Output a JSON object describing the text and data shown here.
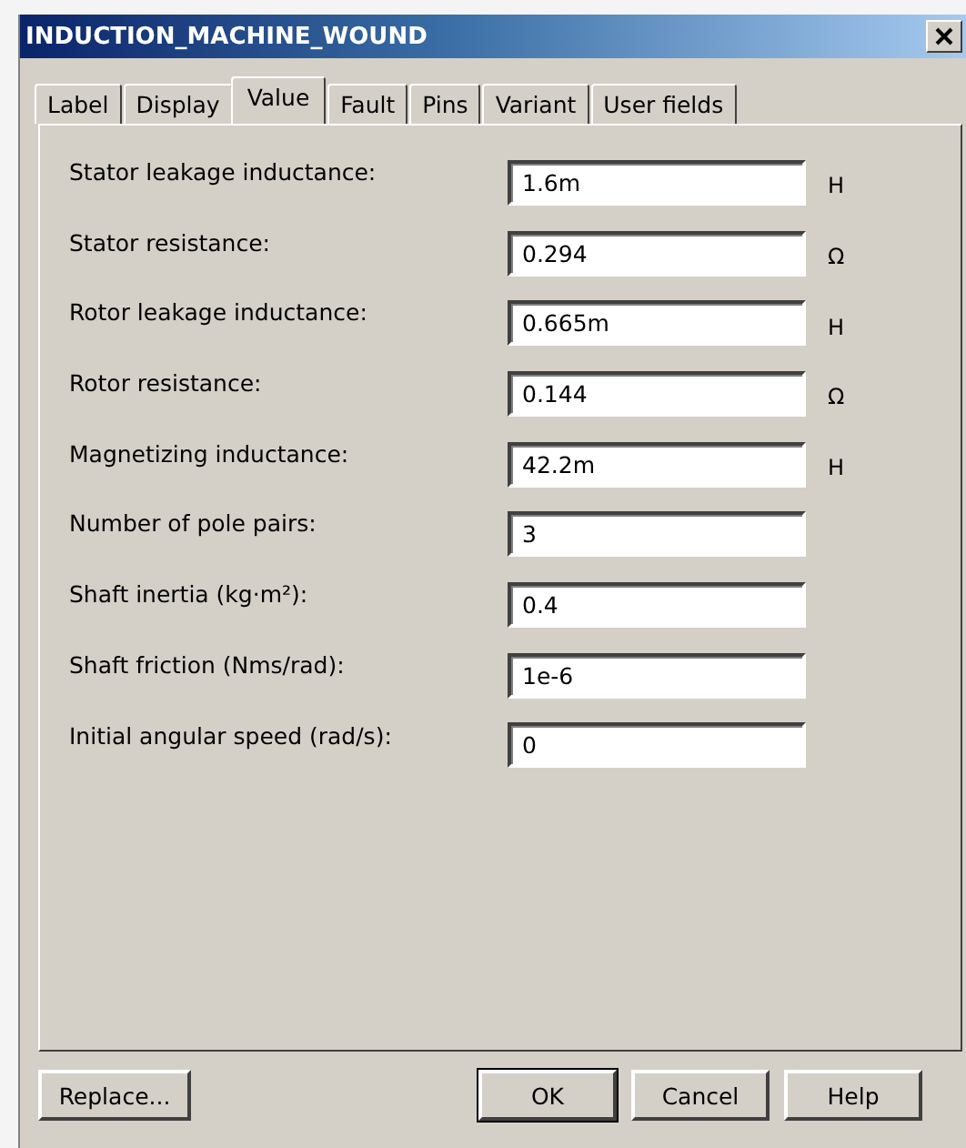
{
  "window": {
    "title": "INDUCTION_MACHINE_WOUND"
  },
  "tabs": [
    {
      "label": "Label",
      "selected": false
    },
    {
      "label": "Display",
      "selected": false
    },
    {
      "label": "Value",
      "selected": true
    },
    {
      "label": "Fault",
      "selected": false
    },
    {
      "label": "Pins",
      "selected": false
    },
    {
      "label": "Variant",
      "selected": false
    },
    {
      "label": "User fields",
      "selected": false
    }
  ],
  "parameters": [
    {
      "label": "Stator leakage inductance:",
      "value": "1.6m",
      "unit": "H"
    },
    {
      "label": "Stator resistance:",
      "value": "0.294",
      "unit": "Ω"
    },
    {
      "label": "Rotor leakage inductance:",
      "value": "0.665m",
      "unit": "H"
    },
    {
      "label": "Rotor resistance:",
      "value": "0.144",
      "unit": "Ω"
    },
    {
      "label": "Magnetizing inductance:",
      "value": "42.2m",
      "unit": "H"
    },
    {
      "label": "Number of pole pairs:",
      "value": "3"
    },
    {
      "label": "Shaft inertia (kg·m²):",
      "value": "0.4"
    },
    {
      "label": "Shaft friction (Nms/rad):",
      "value": "1e-6"
    },
    {
      "label": "Initial angular speed (rad/s):",
      "value": "0"
    }
  ],
  "buttons": [
    {
      "label": "Replace...",
      "default": false
    },
    {
      "label": "OK",
      "default": true
    },
    {
      "label": "Cancel",
      "default": false
    },
    {
      "label": "Help",
      "default": false
    }
  ]
}
